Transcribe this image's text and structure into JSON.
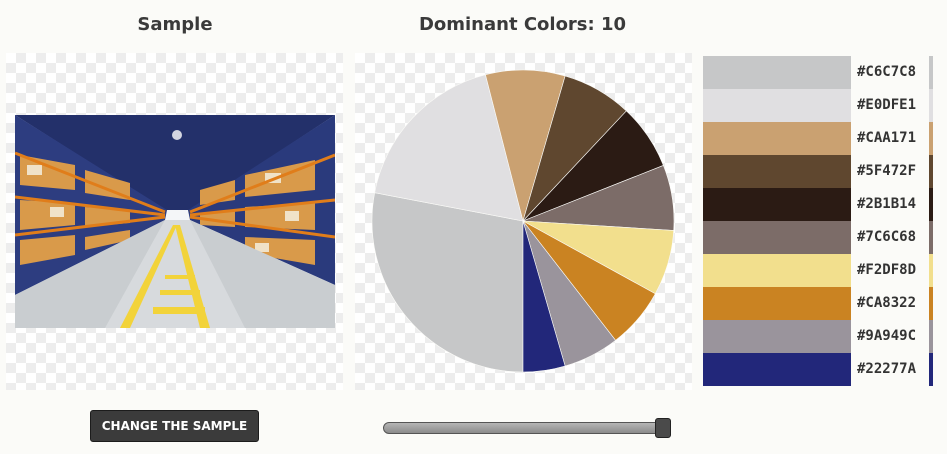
{
  "sample": {
    "title": "Sample",
    "button_label": "CHANGE THE SAMPLE"
  },
  "chart": {
    "title_prefix": "Dominant Colors:",
    "count": "10"
  },
  "slider": {
    "value_fraction": 1.0
  },
  "swatches": [
    {
      "hex": "#C6C7C8",
      "color": "#C6C7C8"
    },
    {
      "hex": "#E0DFE1",
      "color": "#E0DFE1"
    },
    {
      "hex": "#CAA171",
      "color": "#CAA171"
    },
    {
      "hex": "#5F472F",
      "color": "#5F472F"
    },
    {
      "hex": "#2B1B14",
      "color": "#2B1B14"
    },
    {
      "hex": "#7C6C68",
      "color": "#7C6C68"
    },
    {
      "hex": "#F2DF8D",
      "color": "#F2DF8D"
    },
    {
      "hex": "#CA8322",
      "color": "#CA8322"
    },
    {
      "hex": "#9A949C",
      "color": "#9A949C"
    },
    {
      "hex": "#22277A",
      "color": "#22277A"
    }
  ],
  "chart_data": {
    "type": "pie",
    "categories": [
      "#C6C7C8",
      "#E0DFE1",
      "#CAA171",
      "#5F472F",
      "#2B1B14",
      "#7C6C68",
      "#F2DF8D",
      "#CA8322",
      "#9A949C",
      "#22277A"
    ],
    "colors": [
      "#C6C7C8",
      "#E0DFE1",
      "#CAA171",
      "#5F472F",
      "#2B1B14",
      "#7C6C68",
      "#F2DF8D",
      "#CA8322",
      "#9A949C",
      "#22277A"
    ],
    "values": [
      28,
      18,
      8.5,
      7.5,
      7,
      7,
      7,
      6.5,
      6,
      4.5
    ],
    "title": "Dominant Colors: 10"
  }
}
